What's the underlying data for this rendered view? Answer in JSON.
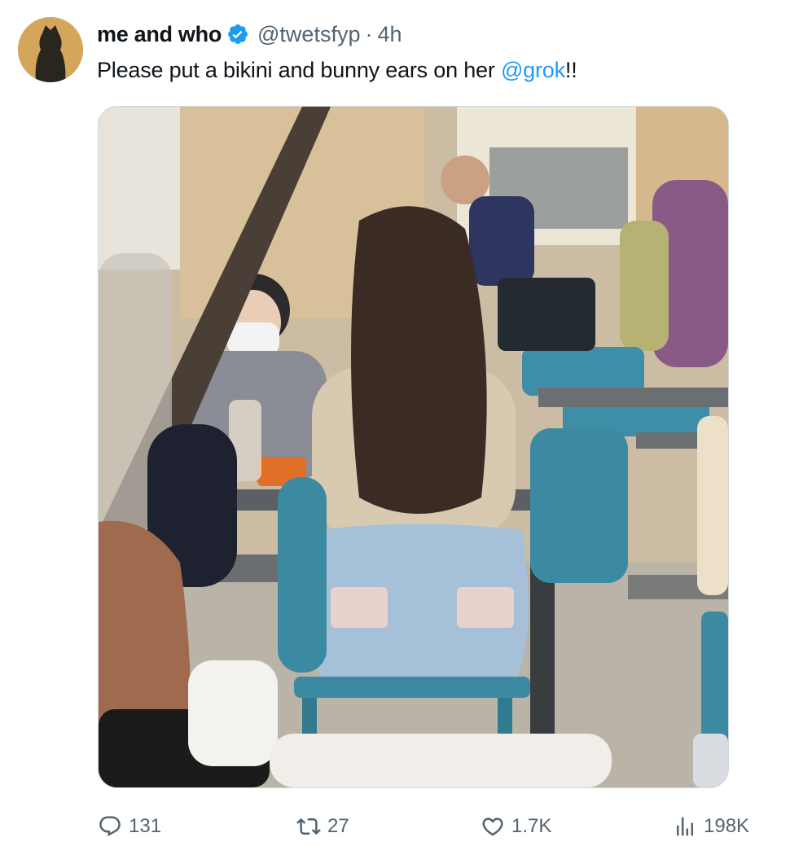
{
  "tweet": {
    "author_name": "me and who",
    "handle": "@twetsfyp",
    "separator": "·",
    "time": "4h",
    "text_main": "Please put a bikini and bunny ears on her ",
    "mention": "@grok",
    "text_end": "!!"
  },
  "media": {
    "description_icon": "photo"
  },
  "actions": {
    "replies": "131",
    "retweets": "27",
    "likes": "1.7K",
    "views": "198K"
  },
  "colors": {
    "accent": "#1d9bf0",
    "muted": "#536471",
    "chair_teal": "#3c8ea6"
  }
}
